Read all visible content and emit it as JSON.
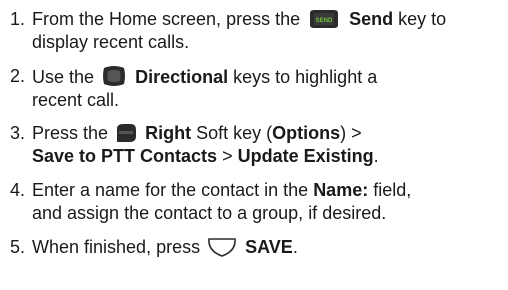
{
  "steps": [
    {
      "number": "1.",
      "t1": "From the Home screen, press the",
      "icon": "send-key-icon",
      "bold1": "Send",
      "t2": "key to",
      "t3": "display recent calls.",
      "icon_text": "SEND"
    },
    {
      "number": "2.",
      "t1": "Use the",
      "icon": "directional-keys-icon",
      "bold1": "Directional",
      "t2": "keys to highlight a",
      "t3": "recent call."
    },
    {
      "number": "3.",
      "t1": "Press the",
      "icon": "right-soft-key-icon",
      "bold1": "Right",
      "t2": "Soft key (",
      "bold2": "Options",
      "t3": ") >",
      "bold3": "Save to PTT Contacts",
      "t4": ">",
      "bold4": "Update Existing",
      "t5": "."
    },
    {
      "number": "4.",
      "t1": "Enter a name for the contact in the",
      "bold1": "Name:",
      "t2": "field,",
      "t3": "and assign the contact to a group, if desired."
    },
    {
      "number": "5.",
      "t1": "When finished, press",
      "icon": "center-soft-key-icon",
      "bold1": "SAVE",
      "t2": "."
    }
  ],
  "colors": {
    "key_fill": "#2b2b2b",
    "send_green": "#6fbf3a",
    "text": "#1a1a1a"
  }
}
